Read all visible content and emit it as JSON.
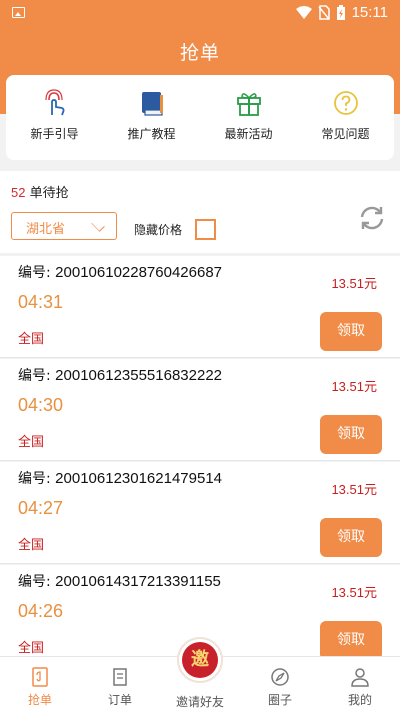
{
  "statusbar": {
    "time": "15:11"
  },
  "header": {
    "title": "抢单"
  },
  "quick_links": [
    {
      "label": "新手引导",
      "icon": "hand-tap-icon"
    },
    {
      "label": "推广教程",
      "icon": "book-icon"
    },
    {
      "label": "最新活动",
      "icon": "gift-icon"
    },
    {
      "label": "常见问题",
      "icon": "question-icon"
    }
  ],
  "filter": {
    "count": "52",
    "count_suffix": " 单待抢",
    "province": "湖北省",
    "hide_price_label": "隐藏价格"
  },
  "orders": [
    {
      "prefix": "编号: ",
      "number": "20010610228760426687",
      "time": "04:31",
      "area": "全国",
      "price": "13.51元",
      "action": "领取"
    },
    {
      "prefix": "编号: ",
      "number": "20010612355516832222",
      "time": "04:30",
      "area": "全国",
      "price": "13.51元",
      "action": "领取"
    },
    {
      "prefix": "编号: ",
      "number": "20010612301621479514",
      "time": "04:27",
      "area": "全国",
      "price": "13.51元",
      "action": "领取"
    },
    {
      "prefix": "编号: ",
      "number": "20010614317213391155",
      "time": "04:26",
      "area": "全国",
      "price": "13.51元",
      "action": "领取"
    }
  ],
  "tabs": [
    {
      "label": "抢单",
      "active": true
    },
    {
      "label": "订单"
    },
    {
      "label": "邀请好友",
      "badge": "邀"
    },
    {
      "label": "圈子"
    },
    {
      "label": "我的"
    }
  ],
  "colors": {
    "accent": "#f08b48",
    "price_red": "#c81f1f",
    "time_orange": "#e8913f"
  }
}
